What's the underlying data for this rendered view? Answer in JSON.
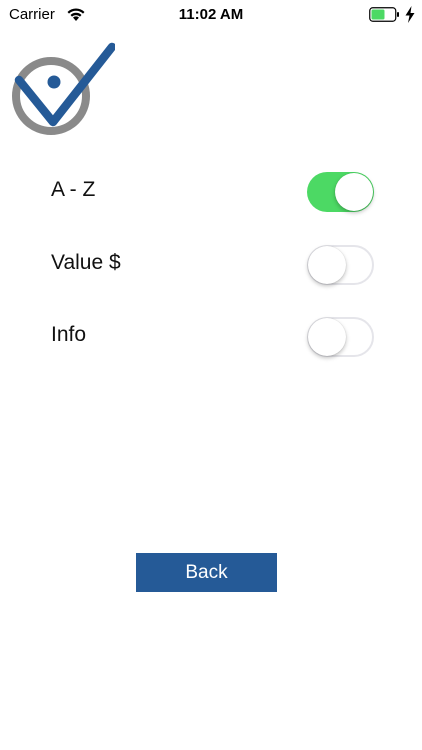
{
  "status_bar": {
    "carrier": "Carrier",
    "time": "11:02 AM",
    "battery_color": "#4cd964",
    "icons": [
      "wifi-icon",
      "battery-icon",
      "charging-bolt-icon"
    ]
  },
  "logo": {
    "icon": "check-person-logo",
    "ring_color": "#8a8a8a",
    "check_color": "#255a97"
  },
  "settings": {
    "rows": [
      {
        "label": "A - Z",
        "enabled": true
      },
      {
        "label": "Value $",
        "enabled": false
      },
      {
        "label": "Info",
        "enabled": false
      }
    ],
    "toggle_on_color": "#4cd964"
  },
  "back_button": {
    "label": "Back",
    "color": "#255a97"
  }
}
